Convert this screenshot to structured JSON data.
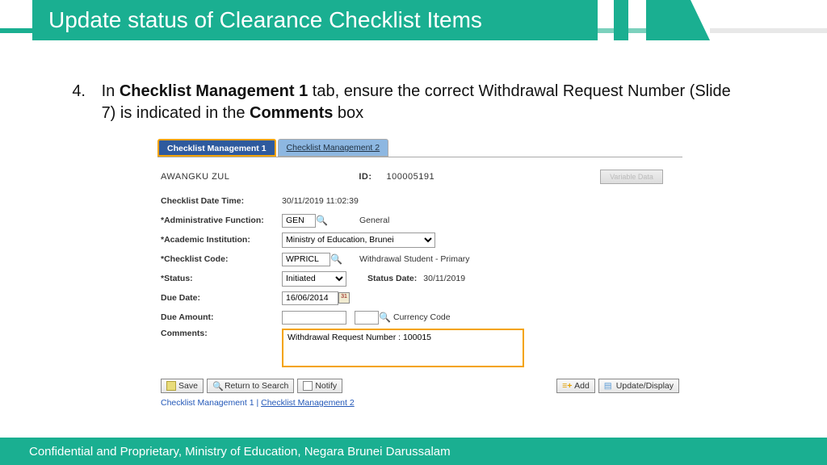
{
  "header": {
    "title": "Update status of Clearance Checklist Items"
  },
  "instruction": {
    "number": "4.",
    "prefix": "In ",
    "bold1": "Checklist Management 1",
    "mid": " tab, ensure the correct Withdrawal Request Number (Slide 7) is indicated in the ",
    "bold2": "Comments",
    "suffix": " box"
  },
  "tabs": {
    "active": "Checklist Management 1",
    "inactive": "Checklist Management 2"
  },
  "form": {
    "student_name": "AWANGKU ZUL",
    "id_label": "ID:",
    "id_value": "100005191",
    "rows": {
      "datetime_label": "Checklist Date Time:",
      "datetime_value": "30/11/2019 11:02:39",
      "admin_func_label": "*Administrative Function:",
      "admin_func_value": "GEN",
      "admin_func_desc": "General",
      "inst_label": "*Academic Institution:",
      "inst_value": "Ministry of Education, Brunei",
      "code_label": "*Checklist Code:",
      "code_value": "WPRICL",
      "code_desc": "Withdrawal Student - Primary",
      "status_label": "*Status:",
      "status_value": "Initiated",
      "status_date_label": "Status Date:",
      "status_date_value": "30/11/2019",
      "due_date_label": "Due Date:",
      "due_date_value": "16/06/2014",
      "due_amount_label": "Due Amount:",
      "currency_label": "Currency Code",
      "comments_label": "Comments:",
      "comments_value": "Withdrawal Request Number : 100015"
    },
    "disabled_btn": "Variable Data"
  },
  "actions": {
    "save": "Save",
    "return": "Return to Search",
    "notify": "Notify",
    "add": "Add",
    "update": "Update/Display"
  },
  "links": {
    "l1": "Checklist Management 1",
    "sep": " | ",
    "l2": "Checklist Management 2"
  },
  "footer": "Confidential and Proprietary, Ministry of Education, Negara Brunei Darussalam"
}
